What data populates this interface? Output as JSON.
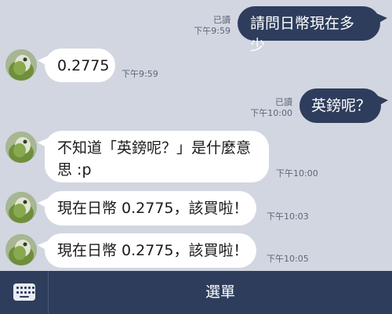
{
  "messages": [
    {
      "dir": "out",
      "text": "請問日幣現在多少",
      "read": "已讀",
      "time": "下午9:59"
    },
    {
      "dir": "in",
      "text": "0.2775",
      "time": "下午9:59"
    },
    {
      "dir": "out",
      "text": "英鎊呢？",
      "read": "已讀",
      "time": "下午10:00"
    },
    {
      "dir": "in",
      "text_line1": "不知道「英鎊呢？」是什麼意",
      "text_line2": "思 :p",
      "time": "下午10:00"
    },
    {
      "dir": "in",
      "text": "現在日幣 0.2775，該買啦！",
      "time": "下午10:03"
    },
    {
      "dir": "in",
      "text": "現在日幣 0.2775，該買啦！",
      "time": "下午10:05"
    }
  ],
  "bottom_bar": {
    "keyboard_icon": "keyboard-icon",
    "menu_label": "選單"
  },
  "colors": {
    "background": "#d2d6e1",
    "outgoing_bubble": "#2e3d5c",
    "incoming_bubble": "#ffffff",
    "bottom_bar": "#2e3d5c"
  }
}
